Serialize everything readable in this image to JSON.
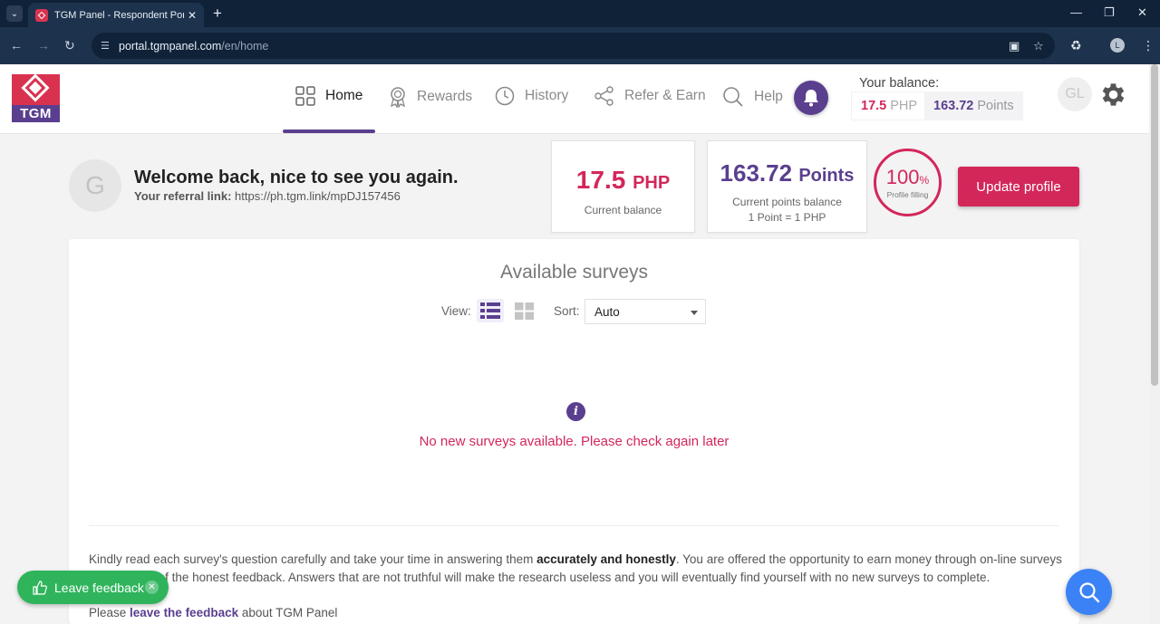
{
  "browser": {
    "tab_title": "TGM Panel - Respondent Portal",
    "url_host": "portal.tgmpanel.com",
    "url_path": "/en/home",
    "profile_initial": "L"
  },
  "logo": {
    "text": "TGM"
  },
  "nav": {
    "home": "Home",
    "rewards": "Rewards",
    "history": "History",
    "refer": "Refer & Earn",
    "help": "Help"
  },
  "header_balance": {
    "label": "Your balance:",
    "php_value": "17.5",
    "php_unit": "PHP",
    "points_value": "163.72",
    "points_unit": "Points"
  },
  "user": {
    "initials": "GL",
    "avatar_letter": "G"
  },
  "welcome": {
    "title": "Welcome back, nice to see you again.",
    "ref_label": "Your referral link:",
    "ref_link": "https://ph.tgm.link/mpDJ157456"
  },
  "cards": {
    "balance_value": "17.5",
    "balance_unit": "PHP",
    "balance_label": "Current balance",
    "points_value": "163.72",
    "points_unit": "Points",
    "points_label": "Current points balance",
    "points_rate": "1 Point = 1 PHP"
  },
  "profile": {
    "percent": "100",
    "percent_sign": "%",
    "label": "Profile filling",
    "button": "Update profile"
  },
  "surveys": {
    "title": "Available surveys",
    "view_label": "View:",
    "sort_label": "Sort:",
    "sort_value": "Auto",
    "empty_message": "No new surveys available. Please check again later"
  },
  "footer_text": {
    "part1": "Kindly read each survey's question carefully and take your time in answering them ",
    "bold": "accurately and honestly",
    "part2": ". You are offered the opportunity to earn money through on-line surveys in exchange of the honest feedback. Answers that are not truthful will make the research useless and you will eventually find yourself with no new surveys to complete.",
    "please": "Please ",
    "link": "leave the feedback",
    "after": " about TGM Panel"
  },
  "feedback_button": {
    "label": "Leave feedback"
  },
  "colors": {
    "brand_red": "#d3275a",
    "brand_purple": "#5a3f8f",
    "feedback_green": "#2fb45c",
    "search_blue": "#3b82f6"
  }
}
